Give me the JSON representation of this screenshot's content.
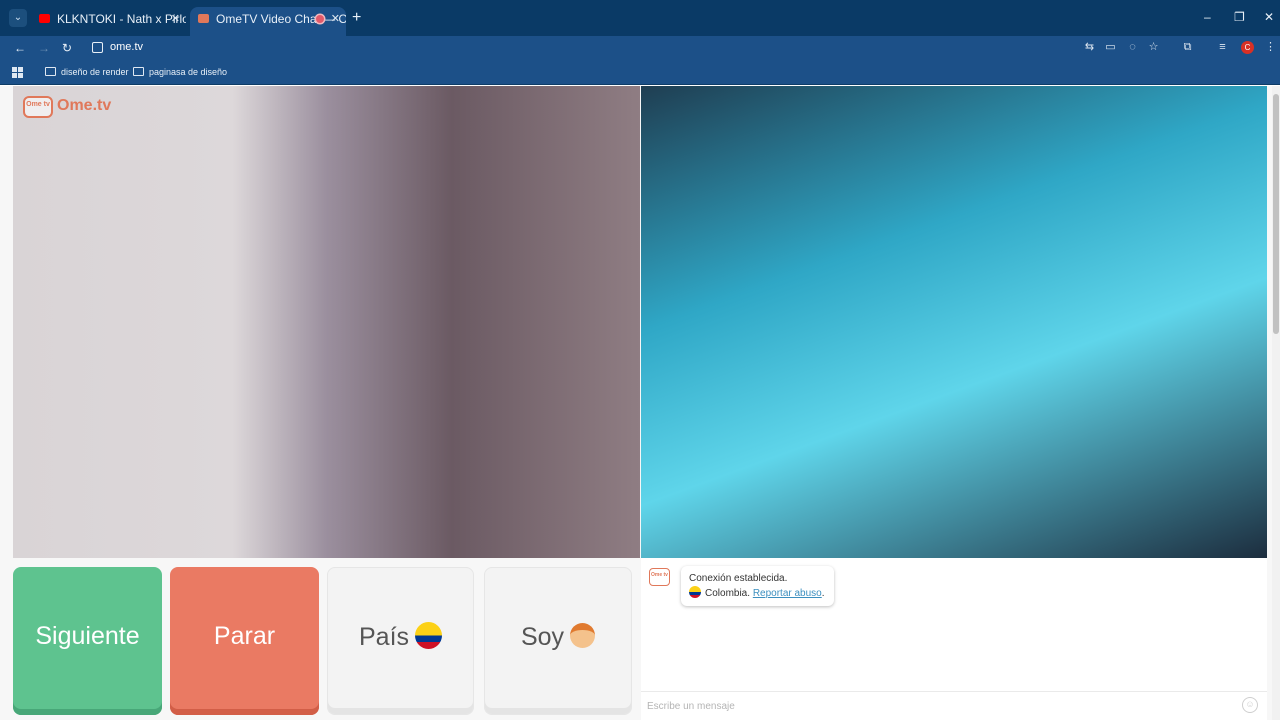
{
  "browser": {
    "tabs": [
      {
        "title": "KLKNTOKI - Nath x Pirlo x Chez",
        "favicon_color": "#ff0000"
      },
      {
        "title": "OmeTV Video Chat — Ome",
        "favicon_color": "#e0785a"
      }
    ],
    "new_tab_icon": "plus-icon",
    "url": "ome.tv",
    "profile_initial": "C",
    "bookmarks": [
      {
        "label": "diseño de render"
      },
      {
        "label": "paginasa de diseño"
      }
    ]
  },
  "site": {
    "logo_text": "Ome.tv",
    "logo_badge": "Ome tv"
  },
  "controls": {
    "next_label": "Siguiente",
    "stop_label": "Parar",
    "country_label": "País",
    "gender_label": "Soy"
  },
  "chat": {
    "bot_badge": "Ome tv",
    "status_message": "Conexión establecida.",
    "country_name": "Colombia.",
    "report_label": "Reportar abuso",
    "report_suffix": ".",
    "input_placeholder": "Escribe un mensaje"
  },
  "colors": {
    "next_button": "#5ec38f",
    "stop_button": "#ea7a63",
    "brand": "#e0785a",
    "link": "#3c8fbf"
  }
}
